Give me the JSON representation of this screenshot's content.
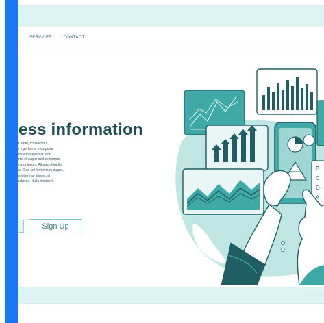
{
  "nav": {
    "items": [
      "SERVICES",
      "CONTACT"
    ]
  },
  "hero": {
    "headline": "ess information",
    "body_lines": [
      "t amet, consectetur",
      "r eget leo et eros porta",
      "ibulum sapien at arcu",
      "rtis et augue sed ex tempus",
      "mpor ipsum. Aliquam fringilla",
      "a. Cras vel fermentum augue,",
      "s vitae nisi aliquet, at",
      "ultrices. Nulla hendrerit"
    ],
    "signup_label": "Sign Up"
  },
  "illustration": {
    "tablet_labels": [
      "B",
      "C",
      "D",
      "A"
    ]
  },
  "colors": {
    "brand_blue": "#1877f2",
    "teal_dark": "#1f5f63",
    "teal_mid": "#3fa9a8",
    "teal_light": "#9fd6d3",
    "teal_pale": "#ddf3f2"
  }
}
